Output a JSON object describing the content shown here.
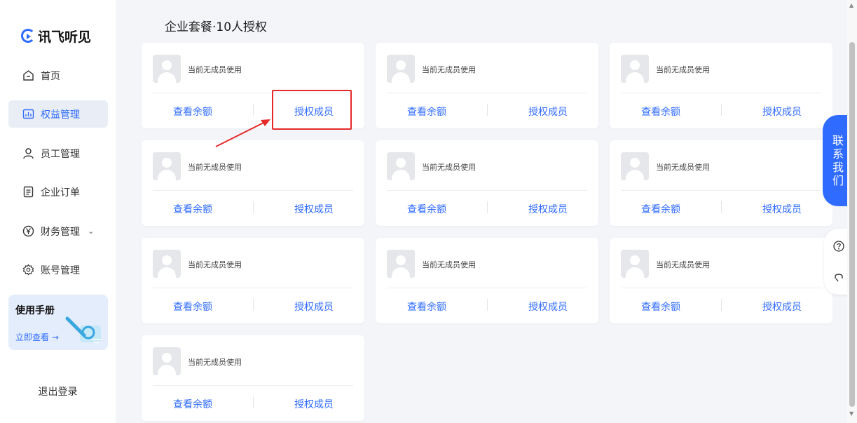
{
  "sidebar": {
    "logo_text": "讯飞听见",
    "items": [
      {
        "label": "首页",
        "icon": "home-icon",
        "active": false
      },
      {
        "label": "权益管理",
        "icon": "chart-icon",
        "active": true
      },
      {
        "label": "员工管理",
        "icon": "user-icon",
        "active": false
      },
      {
        "label": "企业订单",
        "icon": "document-icon",
        "active": false
      },
      {
        "label": "财务管理",
        "icon": "yen-icon",
        "active": false,
        "has_dropdown": true
      },
      {
        "label": "账号管理",
        "icon": "gear-icon",
        "active": false
      }
    ],
    "manual": {
      "title": "使用手册",
      "link": "立即查看 →"
    },
    "logout": "退出登录"
  },
  "main": {
    "title": "企业套餐·10人授权",
    "cards": [
      {
        "member_text": "当前无成员使用",
        "balance_label": "查看余额",
        "auth_label": "授权成员"
      },
      {
        "member_text": "当前无成员使用",
        "balance_label": "查看余额",
        "auth_label": "授权成员"
      },
      {
        "member_text": "当前无成员使用",
        "balance_label": "查看余额",
        "auth_label": "授权成员"
      },
      {
        "member_text": "当前无成员使用",
        "balance_label": "查看余额",
        "auth_label": "授权成员"
      },
      {
        "member_text": "当前无成员使用",
        "balance_label": "查看余额",
        "auth_label": "授权成员"
      },
      {
        "member_text": "当前无成员使用",
        "balance_label": "查看余额",
        "auth_label": "授权成员"
      },
      {
        "member_text": "当前无成员使用",
        "balance_label": "查看余额",
        "auth_label": "授权成员"
      },
      {
        "member_text": "当前无成员使用",
        "balance_label": "查看余额",
        "auth_label": "授权成员"
      },
      {
        "member_text": "当前无成员使用",
        "balance_label": "查看余额",
        "auth_label": "授权成员"
      },
      {
        "member_text": "当前无成员使用",
        "balance_label": "查看余额",
        "auth_label": "授权成员"
      }
    ]
  },
  "float": {
    "contact_chars": [
      "联",
      "系",
      "我",
      "们"
    ],
    "help_icon": "question-icon",
    "service_icon": "headset-icon"
  },
  "colors": {
    "accent": "#2f6bff",
    "highlight": "#e62a2a",
    "background": "#f3f5f9"
  }
}
